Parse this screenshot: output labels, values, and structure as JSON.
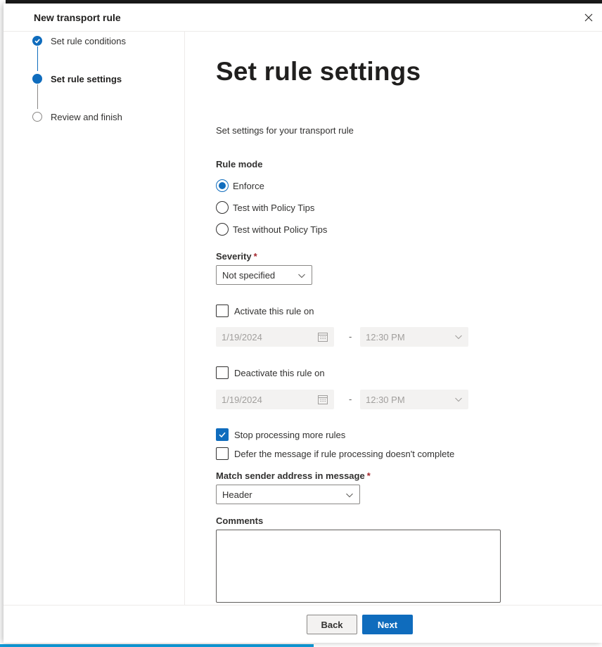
{
  "panel": {
    "title": "New transport rule"
  },
  "steps": [
    {
      "label": "Set rule conditions",
      "state": "done"
    },
    {
      "label": "Set rule settings",
      "state": "current"
    },
    {
      "label": "Review and finish",
      "state": "todo"
    }
  ],
  "main": {
    "title": "Set rule settings",
    "intro": "Set settings for your transport rule",
    "rule_mode": {
      "label": "Rule mode",
      "options": [
        "Enforce",
        "Test with Policy Tips",
        "Test without Policy Tips"
      ],
      "selected": "Enforce"
    },
    "severity": {
      "label": "Severity",
      "required_mark": "*",
      "value": "Not specified"
    },
    "activate": {
      "label": "Activate this rule on",
      "checked": false,
      "date": "1/19/2024",
      "time": "12:30 PM"
    },
    "deactivate": {
      "label": "Deactivate this rule on",
      "checked": false,
      "date": "1/19/2024",
      "time": "12:30 PM"
    },
    "date_separator": "-",
    "stop_processing": {
      "label": "Stop processing more rules",
      "checked": true
    },
    "defer": {
      "label": "Defer the message if rule processing doesn't complete",
      "checked": false
    },
    "match_sender": {
      "label": "Match sender address in message",
      "required_mark": "*",
      "value": "Header"
    },
    "comments": {
      "label": "Comments",
      "value": ""
    }
  },
  "footer": {
    "back_label": "Back",
    "next_label": "Next"
  },
  "colors": {
    "accent": "#0f6cbd",
    "required": "#a4262c"
  },
  "icons": [
    "close-icon",
    "checkmark-icon",
    "chevron-down-icon",
    "calendar-icon"
  ]
}
